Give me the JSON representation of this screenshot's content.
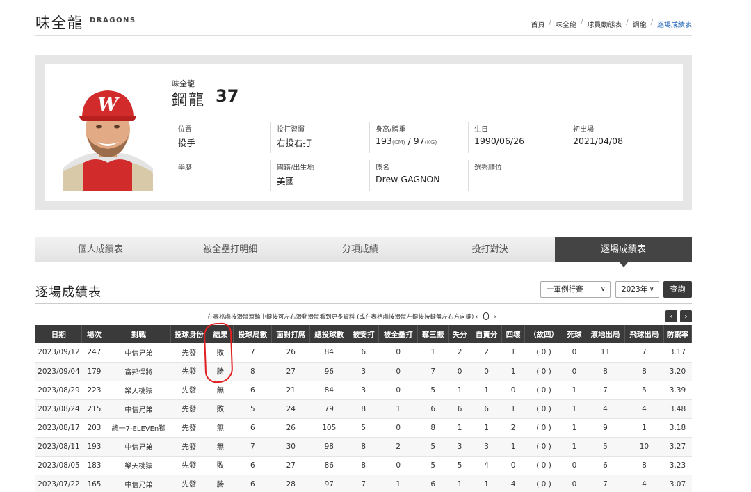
{
  "header": {
    "team_name": "味全龍",
    "team_en": "DRAGONS",
    "breadcrumb": [
      "首頁",
      "味全龍",
      "球員動態表",
      "鋼龍",
      "逐場成績表"
    ]
  },
  "player": {
    "team": "味全龍",
    "name": "鋼龍",
    "number": "37",
    "info": [
      {
        "label": "位置",
        "value": "投手"
      },
      {
        "label": "投打習慣",
        "value": "右投右打"
      },
      {
        "label": "身高/體重",
        "height": "193",
        "height_unit": "(CM)",
        "slash": " / ",
        "weight": "97",
        "weight_unit": "(KG)"
      },
      {
        "label": "生日",
        "value": "1990/06/26"
      },
      {
        "label": "初出場",
        "value": "2021/04/08"
      },
      {
        "label": "學歷",
        "value": ""
      },
      {
        "label": "國籍/出生地",
        "value": "美國"
      },
      {
        "label": "原名",
        "value": "Drew GAGNON"
      },
      {
        "label": "選秀順位",
        "value": ""
      }
    ]
  },
  "tabs": [
    "個人成績表",
    "被全壘打明細",
    "分項成績",
    "投打對決",
    "逐場成績表"
  ],
  "section": {
    "title": "逐場成績表",
    "select_type": "一軍例行賽",
    "select_year": "2023年",
    "query_label": "查詢",
    "hint": "在表格處按滑鼠滾輪中鍵後可左右滑動滑鼠看到更多資料 (或在表格處按滑鼠左鍵後按鍵盤左右方向鍵) ←",
    "hint_arrow": "→",
    "prev_icon": "‹",
    "next_icon": "›"
  },
  "table": {
    "columns": [
      "日期",
      "場次",
      "對戰",
      "投球身份",
      "結果",
      "投球局數",
      "面對打席",
      "總投球數",
      "被安打",
      "被全壘打",
      "奪三振",
      "失分",
      "自責分",
      "四壞",
      "（故四）",
      "死球",
      "滾地出局",
      "飛球出局",
      "防禦率"
    ],
    "rows": [
      [
        "2023/09/12",
        "247",
        "中信兄弟",
        "先發",
        "敗",
        "7",
        "26",
        "84",
        "6",
        "0",
        "1",
        "2",
        "2",
        "1",
        "( 0 )",
        "0",
        "11",
        "7",
        "3.17"
      ],
      [
        "2023/09/04",
        "179",
        "富邦悍將",
        "先發",
        "勝",
        "8",
        "27",
        "96",
        "3",
        "0",
        "7",
        "0",
        "0",
        "1",
        "( 0 )",
        "0",
        "8",
        "8",
        "3.20"
      ],
      [
        "2023/08/29",
        "223",
        "樂天桃猿",
        "先發",
        "無",
        "6",
        "21",
        "84",
        "3",
        "0",
        "5",
        "1",
        "1",
        "0",
        "( 0 )",
        "1",
        "7",
        "5",
        "3.39"
      ],
      [
        "2023/08/24",
        "215",
        "中信兄弟",
        "先發",
        "敗",
        "5",
        "24",
        "79",
        "8",
        "1",
        "6",
        "6",
        "6",
        "1",
        "( 0 )",
        "1",
        "4",
        "4",
        "3.48"
      ],
      [
        "2023/08/17",
        "203",
        "統一7-ELEVEn獅",
        "先發",
        "無",
        "6",
        "26",
        "105",
        "5",
        "0",
        "8",
        "1",
        "1",
        "2",
        "( 0 )",
        "1",
        "9",
        "1",
        "3.18"
      ],
      [
        "2023/08/11",
        "193",
        "中信兄弟",
        "先發",
        "無",
        "7",
        "30",
        "98",
        "8",
        "2",
        "5",
        "3",
        "3",
        "1",
        "( 0 )",
        "1",
        "5",
        "10",
        "3.27"
      ],
      [
        "2023/08/05",
        "183",
        "樂天桃猿",
        "先發",
        "敗",
        "6",
        "27",
        "86",
        "8",
        "0",
        "5",
        "5",
        "4",
        "0",
        "( 0 )",
        "0",
        "6",
        "8",
        "3.23"
      ],
      [
        "2023/07/22",
        "165",
        "中信兄弟",
        "先發",
        "勝",
        "6",
        "28",
        "97",
        "7",
        "1",
        "6",
        "1",
        "1",
        "4",
        "( 0 )",
        "0",
        "7",
        "4",
        "3.07"
      ]
    ]
  }
}
